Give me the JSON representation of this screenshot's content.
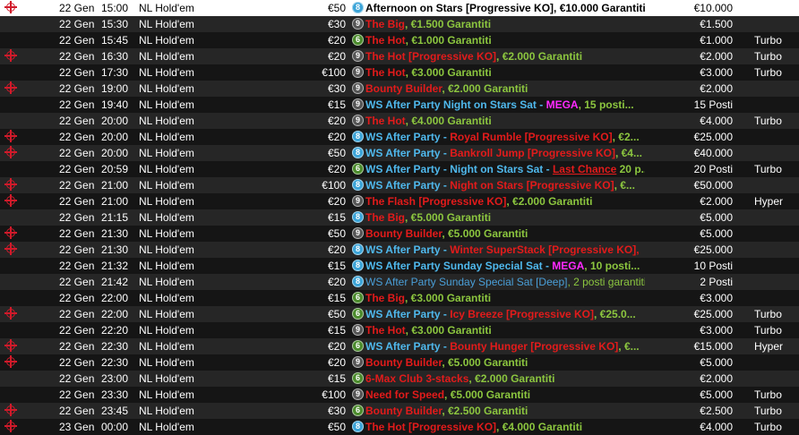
{
  "colors": {
    "row_odd": "#262626",
    "row_even": "#151515",
    "highlight_row": "#ffffff",
    "red": "#e21b1b",
    "green": "#8cc63f",
    "blue": "#4fb8ec",
    "magenta": "#ff2aff",
    "ko_icon": "#d11a2a"
  },
  "tournaments": [
    {
      "ko": true,
      "date": "22 Gen",
      "time": "15:00",
      "game": "NL Hold'em",
      "buyin": "€50",
      "players": "8",
      "name": [
        {
          "t": "Afternoon on Stars [Progressive KO], €10.000 Garantiti",
          "c": "blk"
        }
      ],
      "prize": "€10.000",
      "speed": ""
    },
    {
      "ko": false,
      "date": "22 Gen",
      "time": "15:30",
      "game": "NL Hold'em",
      "buyin": "€30",
      "players": "9",
      "name": [
        {
          "t": "The Big",
          "c": "red"
        },
        {
          "t": ", €1.500 Garantiti",
          "c": "green"
        }
      ],
      "prize": "€1.500",
      "speed": ""
    },
    {
      "ko": false,
      "date": "22 Gen",
      "time": "15:45",
      "game": "NL Hold'em",
      "buyin": "€20",
      "players": "6",
      "name": [
        {
          "t": "The Hot",
          "c": "red"
        },
        {
          "t": ", €1.000 Garantiti",
          "c": "green"
        }
      ],
      "prize": "€1.000",
      "speed": "Turbo"
    },
    {
      "ko": true,
      "date": "22 Gen",
      "time": "16:30",
      "game": "NL Hold'em",
      "buyin": "€20",
      "players": "9",
      "name": [
        {
          "t": "The Hot [Progressive KO]",
          "c": "red"
        },
        {
          "t": ", €2.000 Garantiti",
          "c": "green"
        }
      ],
      "prize": "€2.000",
      "speed": "Turbo"
    },
    {
      "ko": false,
      "date": "22 Gen",
      "time": "17:30",
      "game": "NL Hold'em",
      "buyin": "€100",
      "players": "9",
      "name": [
        {
          "t": "The Hot",
          "c": "red"
        },
        {
          "t": ", €3.000 Garantiti",
          "c": "green"
        }
      ],
      "prize": "€3.000",
      "speed": "Turbo"
    },
    {
      "ko": true,
      "date": "22 Gen",
      "time": "19:00",
      "game": "NL Hold'em",
      "buyin": "€30",
      "players": "9",
      "name": [
        {
          "t": "Bounty Builder",
          "c": "red"
        },
        {
          "t": ", €2.000 Garantiti",
          "c": "green"
        }
      ],
      "prize": "€2.000",
      "speed": ""
    },
    {
      "ko": false,
      "date": "22 Gen",
      "time": "19:40",
      "game": "NL Hold'em",
      "buyin": "€15",
      "players": "9",
      "name": [
        {
          "t": "WS After Party Night on Stars Sat",
          "c": "blue"
        },
        {
          "t": " - ",
          "c": "blue"
        },
        {
          "t": "MEGA",
          "c": "mag"
        },
        {
          "t": ", 15 posti...",
          "c": "green"
        }
      ],
      "prize": "15 Posti",
      "speed": ""
    },
    {
      "ko": false,
      "date": "22 Gen",
      "time": "20:00",
      "game": "NL Hold'em",
      "buyin": "€20",
      "players": "9",
      "name": [
        {
          "t": "The Hot",
          "c": "red"
        },
        {
          "t": ", €4.000 Garantiti",
          "c": "green"
        }
      ],
      "prize": "€4.000",
      "speed": "Turbo"
    },
    {
      "ko": true,
      "date": "22 Gen",
      "time": "20:00",
      "game": "NL Hold'em",
      "buyin": "€20",
      "players": "8",
      "name": [
        {
          "t": "WS After Party",
          "c": "blue"
        },
        {
          "t": " - ",
          "c": "blue"
        },
        {
          "t": "Royal Rumble [Progressive KO]",
          "c": "red"
        },
        {
          "t": ", €2...",
          "c": "green"
        }
      ],
      "prize": "€25.000",
      "speed": ""
    },
    {
      "ko": true,
      "date": "22 Gen",
      "time": "20:00",
      "game": "NL Hold'em",
      "buyin": "€50",
      "players": "8",
      "name": [
        {
          "t": "WS After Party",
          "c": "blue"
        },
        {
          "t": " - ",
          "c": "blue"
        },
        {
          "t": "Bankroll Jump [Progressive KO]",
          "c": "red"
        },
        {
          "t": ", €4...",
          "c": "green"
        }
      ],
      "prize": "€40.000",
      "speed": ""
    },
    {
      "ko": false,
      "date": "22 Gen",
      "time": "20:59",
      "game": "NL Hold'em",
      "buyin": "€20",
      "players": "6",
      "name": [
        {
          "t": "WS After Party - Night on Stars Sat ",
          "c": "blue"
        },
        {
          "t": "- ",
          "c": "blue"
        },
        {
          "t": "Last Chance",
          "c": "red u"
        },
        {
          "t": " 20 p...",
          "c": "green"
        }
      ],
      "prize": "20 Posti",
      "speed": "Turbo"
    },
    {
      "ko": true,
      "date": "22 Gen",
      "time": "21:00",
      "game": "NL Hold'em",
      "buyin": "€100",
      "players": "8",
      "name": [
        {
          "t": "WS After Party",
          "c": "blue"
        },
        {
          "t": " - ",
          "c": "blue"
        },
        {
          "t": "Night on Stars [Progressive KO]",
          "c": "red"
        },
        {
          "t": ", €...",
          "c": "green"
        }
      ],
      "prize": "€50.000",
      "speed": ""
    },
    {
      "ko": true,
      "date": "22 Gen",
      "time": "21:00",
      "game": "NL Hold'em",
      "buyin": "€20",
      "players": "9",
      "name": [
        {
          "t": "The Flash [Progressive KO]",
          "c": "red"
        },
        {
          "t": ", €2.000 Garantiti",
          "c": "green"
        }
      ],
      "prize": "€2.000",
      "speed": "Hyper"
    },
    {
      "ko": false,
      "date": "22 Gen",
      "time": "21:15",
      "game": "NL Hold'em",
      "buyin": "€15",
      "players": "8",
      "name": [
        {
          "t": "The Big",
          "c": "red"
        },
        {
          "t": ", €5.000 Garantiti",
          "c": "green"
        }
      ],
      "prize": "€5.000",
      "speed": ""
    },
    {
      "ko": true,
      "date": "22 Gen",
      "time": "21:30",
      "game": "NL Hold'em",
      "buyin": "€50",
      "players": "9",
      "name": [
        {
          "t": "Bounty Builder",
          "c": "red"
        },
        {
          "t": ", €5.000 Garantiti",
          "c": "green"
        }
      ],
      "prize": "€5.000",
      "speed": ""
    },
    {
      "ko": true,
      "date": "22 Gen",
      "time": "21:30",
      "game": "NL Hold'em",
      "buyin": "€20",
      "players": "8",
      "name": [
        {
          "t": "WS After Party",
          "c": "blue"
        },
        {
          "t": " - ",
          "c": "blue"
        },
        {
          "t": "Winter SuperStack [Progressive KO],",
          "c": "red"
        }
      ],
      "prize": "€25.000",
      "speed": ""
    },
    {
      "ko": false,
      "date": "22 Gen",
      "time": "21:32",
      "game": "NL Hold'em",
      "buyin": "€15",
      "players": "8",
      "name": [
        {
          "t": "WS After Party Sunday Special Sat",
          "c": "blue"
        },
        {
          "t": " - ",
          "c": "blue"
        },
        {
          "t": "MEGA",
          "c": "mag"
        },
        {
          "t": ", 10 posti...",
          "c": "green"
        }
      ],
      "prize": "10 Posti",
      "speed": ""
    },
    {
      "ko": false,
      "date": "22 Gen",
      "time": "21:42",
      "game": "NL Hold'em",
      "buyin": "€20",
      "players": "8",
      "name": [
        {
          "t": "WS After Party Sunday Special Sat [Deep]",
          "c": "bluep"
        },
        {
          "t": ", 2 posti garantiti",
          "c": "greenp"
        }
      ],
      "prize": "2 Posti",
      "speed": ""
    },
    {
      "ko": false,
      "date": "22 Gen",
      "time": "22:00",
      "game": "NL Hold'em",
      "buyin": "€15",
      "players": "6",
      "name": [
        {
          "t": "The Big",
          "c": "red"
        },
        {
          "t": ", €3.000 Garantiti",
          "c": "green"
        }
      ],
      "prize": "€3.000",
      "speed": ""
    },
    {
      "ko": true,
      "date": "22 Gen",
      "time": "22:00",
      "game": "NL Hold'em",
      "buyin": "€50",
      "players": "6",
      "name": [
        {
          "t": "WS After Party",
          "c": "blue"
        },
        {
          "t": " - ",
          "c": "blue"
        },
        {
          "t": "Icy Breeze [Progressive KO]",
          "c": "red"
        },
        {
          "t": ", €25.0...",
          "c": "green"
        }
      ],
      "prize": "€25.000",
      "speed": "Turbo"
    },
    {
      "ko": false,
      "date": "22 Gen",
      "time": "22:20",
      "game": "NL Hold'em",
      "buyin": "€15",
      "players": "9",
      "name": [
        {
          "t": "The Hot",
          "c": "red"
        },
        {
          "t": ", €3.000 Garantiti",
          "c": "green"
        }
      ],
      "prize": "€3.000",
      "speed": "Turbo"
    },
    {
      "ko": true,
      "date": "22 Gen",
      "time": "22:30",
      "game": "NL Hold'em",
      "buyin": "€20",
      "players": "6",
      "name": [
        {
          "t": "WS After Party",
          "c": "blue"
        },
        {
          "t": " - ",
          "c": "blue"
        },
        {
          "t": "Bounty Hunger [Progressive KO]",
          "c": "red"
        },
        {
          "t": ", €...",
          "c": "green"
        }
      ],
      "prize": "€15.000",
      "speed": "Hyper"
    },
    {
      "ko": true,
      "date": "22 Gen",
      "time": "22:30",
      "game": "NL Hold'em",
      "buyin": "€20",
      "players": "9",
      "name": [
        {
          "t": "Bounty Builder",
          "c": "red"
        },
        {
          "t": ", €5.000 Garantiti",
          "c": "green"
        }
      ],
      "prize": "€5.000",
      "speed": ""
    },
    {
      "ko": false,
      "date": "22 Gen",
      "time": "23:00",
      "game": "NL Hold'em",
      "buyin": "€15",
      "players": "6",
      "name": [
        {
          "t": "6-Max Club 3-stacks",
          "c": "red"
        },
        {
          "t": ", €2.000 Garantiti",
          "c": "green"
        }
      ],
      "prize": "€2.000",
      "speed": ""
    },
    {
      "ko": false,
      "date": "22 Gen",
      "time": "23:30",
      "game": "NL Hold'em",
      "buyin": "€100",
      "players": "9",
      "name": [
        {
          "t": "Need for Speed",
          "c": "red"
        },
        {
          "t": ", €5.000 Garantiti",
          "c": "green"
        }
      ],
      "prize": "€5.000",
      "speed": "Turbo"
    },
    {
      "ko": true,
      "date": "22 Gen",
      "time": "23:45",
      "game": "NL Hold'em",
      "buyin": "€30",
      "players": "6",
      "name": [
        {
          "t": "Bounty Builder",
          "c": "red"
        },
        {
          "t": ", €2.500 Garantiti",
          "c": "green"
        }
      ],
      "prize": "€2.500",
      "speed": "Turbo"
    },
    {
      "ko": true,
      "date": "23 Gen",
      "time": "00:00",
      "game": "NL Hold'em",
      "buyin": "€50",
      "players": "8",
      "name": [
        {
          "t": "The Hot [Progressive KO]",
          "c": "red"
        },
        {
          "t": ", €4.000 Garantiti",
          "c": "green"
        }
      ],
      "prize": "€4.000",
      "speed": "Turbo"
    }
  ]
}
